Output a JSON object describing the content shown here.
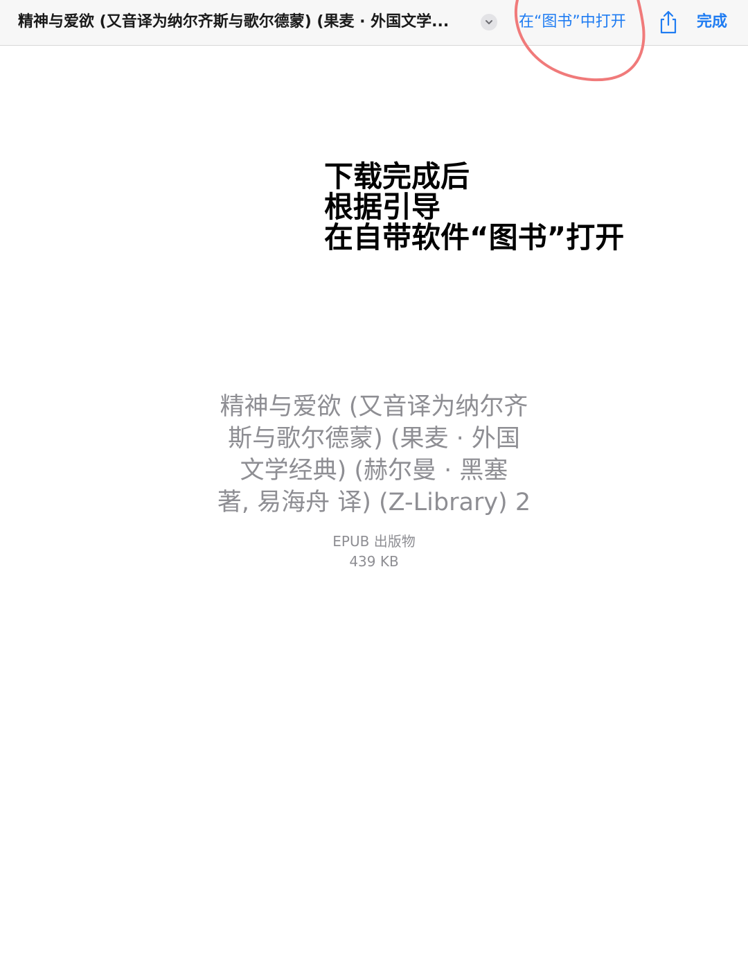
{
  "header": {
    "title": "精神与爱欲 (又音译为纳尔齐斯与歌尔德蒙) (果麦 · 外国文学...",
    "open_in_books_label": "在“图书”中打开",
    "done_label": "完成"
  },
  "annotation": {
    "lines": [
      "下载完成后",
      "根据引导",
      "在自带软件“图书”打开"
    ],
    "circle_color": "#f07a7a"
  },
  "file": {
    "name_lines": [
      "精神与爱欲 (又音译为纳尔齐",
      "斯与歌尔德蒙) (果麦 · 外国",
      "文学经典) (赫尔曼 · 黑塞",
      "著, 易海舟 译) (Z-Library) 2"
    ],
    "type": "EPUB 出版物",
    "size": "439 KB"
  },
  "colors": {
    "accent": "#1f7cf2",
    "secondary_text": "#8e8e93"
  }
}
